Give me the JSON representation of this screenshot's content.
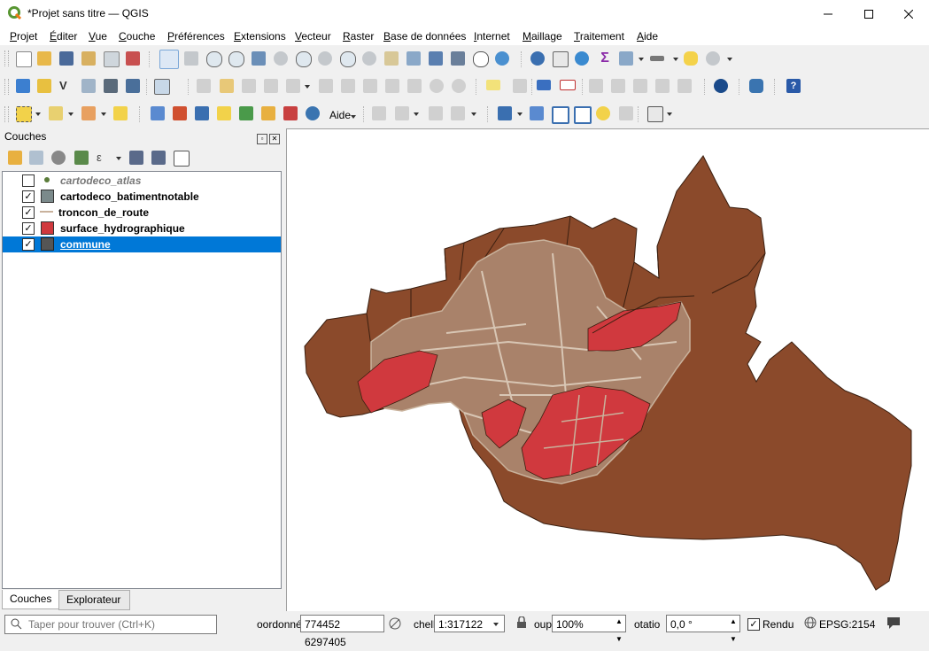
{
  "window": {
    "title": "*Projet sans titre — QGIS"
  },
  "menu": [
    "Projet",
    "Éditer",
    "Vue",
    "Couche",
    "Préférences",
    "Extensions",
    "Vecteur",
    "Raster",
    "Base de données",
    "Internet",
    "Maillage",
    "Traitement",
    "Aide"
  ],
  "toolbar3": {
    "aide_label": "Aide"
  },
  "layers_panel": {
    "title": "Couches",
    "layers": [
      {
        "name": "cartodeco_atlas",
        "checked": false,
        "symbol": "point",
        "color": "#5b7d3a"
      },
      {
        "name": "cartodeco_batimentnotable",
        "checked": true,
        "symbol": "polygon",
        "color": "#7b8a8b"
      },
      {
        "name": "troncon_de_route",
        "checked": true,
        "symbol": "line",
        "color": "#c9b29c"
      },
      {
        "name": "surface_hydrographique",
        "checked": true,
        "symbol": "polygon",
        "color": "#d0393e"
      },
      {
        "name": "commune",
        "checked": true,
        "symbol": "polygon",
        "color": "#555555"
      }
    ],
    "tabs": [
      "Couches",
      "Explorateur"
    ]
  },
  "map": {
    "background": "#ffffff",
    "commune_fill": "#8b4a2b",
    "water_fill": "#d0393e",
    "road_color": "#c9b29c"
  },
  "statusbar": {
    "search_placeholder": "Taper pour trouver (Ctrl+K)",
    "coord_label": "oordonné",
    "coord_value": "774452 6297405",
    "scale_label": "chell",
    "scale_value": "1:317122",
    "zoom_label": "oup",
    "zoom_value": "100%",
    "rotation_label": "otatio",
    "rotation_value": "0,0 °",
    "render_label": "Rendu",
    "crs_label": "EPSG:2154"
  }
}
